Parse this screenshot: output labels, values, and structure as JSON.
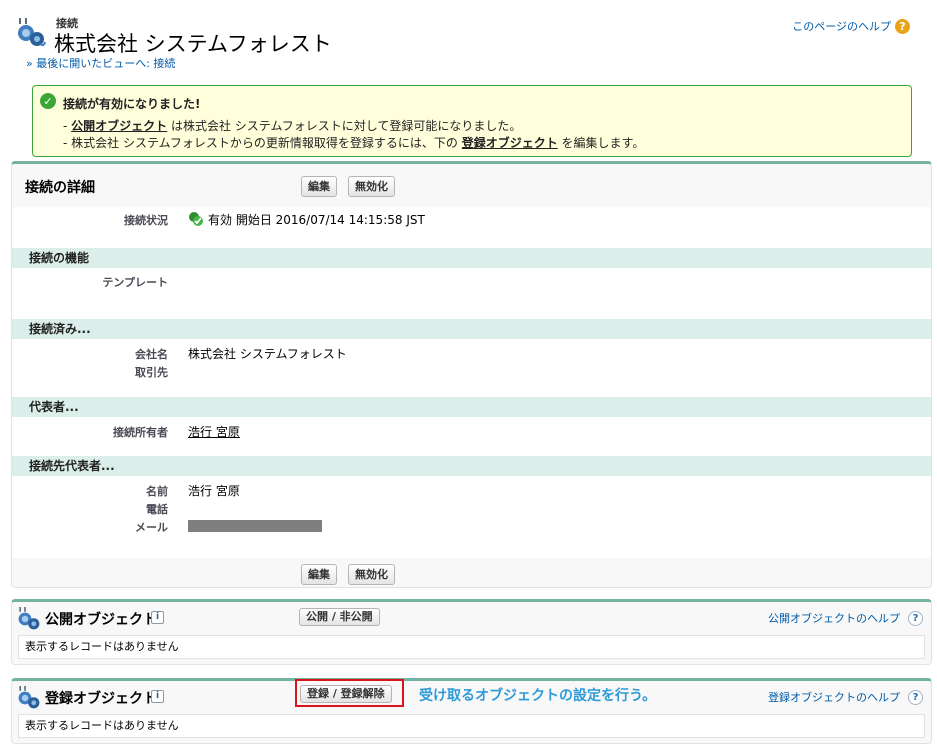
{
  "header": {
    "type_label": "接続",
    "title": "株式会社 システムフォレスト",
    "breadcrumb": "» 最後に開いたビューへ: 接続",
    "help_link": "このページのヘルプ"
  },
  "message": {
    "title": "接続が有効になりました!",
    "line1_prefix": "- ",
    "line1_link": "公開オブジェクト",
    "line1_suffix": " は株式会社 システムフォレストに対して登録可能になりました。",
    "line2_prefix": "- 株式会社 システムフォレストからの更新情報取得を登録するには、下の ",
    "line2_link": "登録オブジェクト",
    "line2_suffix": " を編集します。"
  },
  "detail": {
    "title": "接続の詳細",
    "edit_label": "編集",
    "deactivate_label": "無効化",
    "status_label": "接続状況",
    "status_value": "有効 開始日 2016/07/14 14:15:58 JST",
    "sections": {
      "features": "接続の機能",
      "connected": "接続済み...",
      "representative": "代表者...",
      "remote_rep": "接続先代表者..."
    },
    "template_label": "テンプレート",
    "company_label": "会社名",
    "company_value": "株式会社 システムフォレスト",
    "account_label": "取引先",
    "owner_label": "接続所有者",
    "owner_value": "浩行 宮原",
    "name_label": "名前",
    "name_value": "浩行 宮原",
    "phone_label": "電話",
    "email_label": "メール"
  },
  "published": {
    "title": "公開オブジェクト",
    "info": "i",
    "button": "公開 / 非公開",
    "help": "公開オブジェクトのヘルプ",
    "empty": "表示するレコードはありません"
  },
  "subscribed": {
    "title": "登録オブジェクト",
    "info": "i",
    "button": "登録 / 登録解除",
    "annotation": "受け取るオブジェクトの設定を行う。",
    "help": "登録オブジェクトのヘルプ",
    "empty": "表示するレコードはありません"
  },
  "icons": {
    "connection": "connection-plug-icon",
    "help_orange": "?",
    "help_blue": "?",
    "check": "✓"
  },
  "colors": {
    "link": "#015ba7",
    "accent": "#74b3a1",
    "section_bg": "#dbeee9",
    "message_bg": "#ffffdc",
    "annotation": "#2e9ad7",
    "highlight": "#d9141b"
  }
}
